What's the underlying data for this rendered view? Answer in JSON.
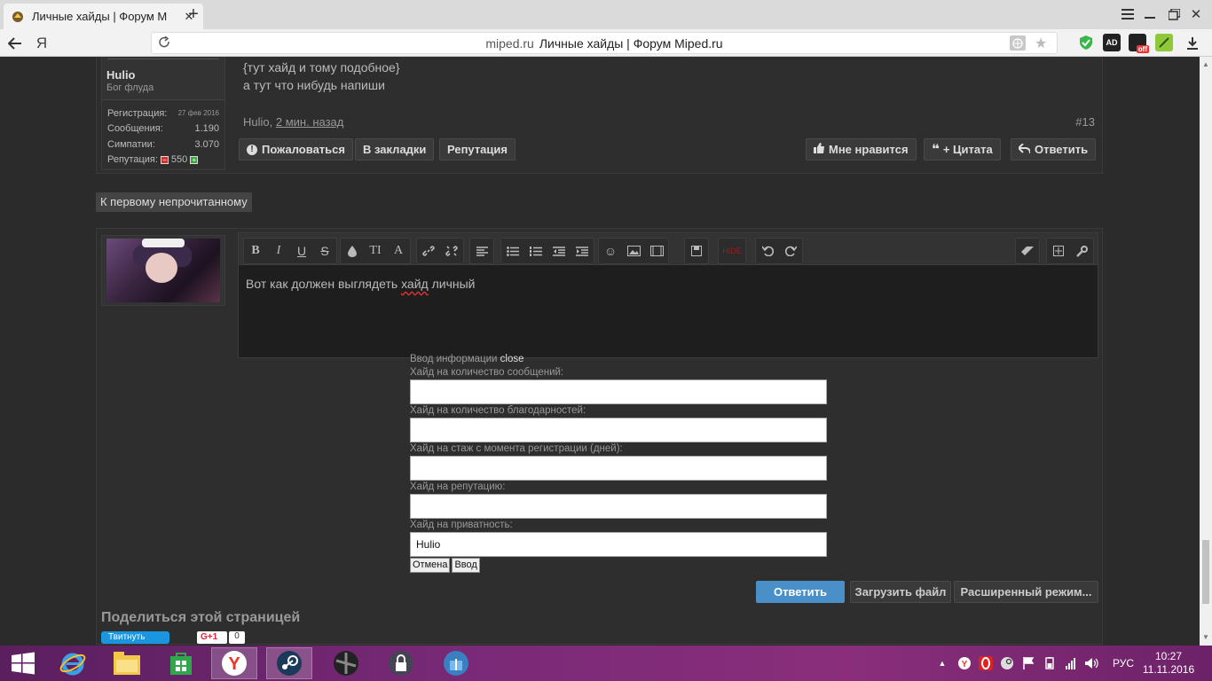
{
  "browser": {
    "tab_title": "Личные хайды | Форум M",
    "url_domain": "miped.ru",
    "url_title": "Личные хайды | Форум Miped.ru",
    "home_letter": "Я",
    "ext_ad": "AD",
    "ext_off": "off"
  },
  "post": {
    "username": "Hulio",
    "user_title": "Бог флуда",
    "stats": [
      {
        "label": "Регистрация:",
        "value": "27 фев 2016"
      },
      {
        "label": "Сообщения:",
        "value": "1.190"
      },
      {
        "label": "Симпатии:",
        "value": "3.070"
      }
    ],
    "rep_label": "Репутация:",
    "rep_value": "550",
    "rep_minus": "−",
    "rep_plus": "+",
    "line1": "{тут хайд и тому подобное}",
    "line2": "а тут что нибудь напиши",
    "author": "Hulio",
    "sep": ",",
    "time": "2 мин. назад",
    "number": "#13",
    "buttons": {
      "report": "Пожаловаться",
      "bookmark": "В закладки",
      "reputation": "Репутация",
      "like": "Мне нравится",
      "quote": "+ Цитата",
      "reply": "Ответить"
    }
  },
  "unread_link": "К первому непрочитанному",
  "editor": {
    "text_before": "Вот как должен выглядеть ",
    "text_mis": "хайд",
    "text_after": " личный",
    "hide_label": "HIDE"
  },
  "hideform": {
    "title": "Ввод информации",
    "close": "close",
    "labels": [
      "Хайд на количество сообщений:",
      "Хайд на количество благодарностей:",
      "Хайд на стаж с момента регистрации (дней):",
      "Хайд на репутацию:",
      "Хайд на приватность:"
    ],
    "values": [
      "",
      "",
      "",
      "",
      "Hulio"
    ],
    "cancel": "Отмена",
    "submit": "Ввод"
  },
  "actions": {
    "reply": "Ответить",
    "upload": "Загрузить файл",
    "advanced": "Расширенный режим..."
  },
  "share": {
    "title": "Поделиться этой страницей",
    "tweet": "Твитнуть",
    "gplus": "G+1",
    "gcount": "0"
  },
  "taskbar": {
    "lang": "РУС",
    "time": "10:27",
    "date": "11.11.2016"
  },
  "colors": {
    "accent_blue": "#4a90c8",
    "page_bg": "#2b2b2b"
  }
}
